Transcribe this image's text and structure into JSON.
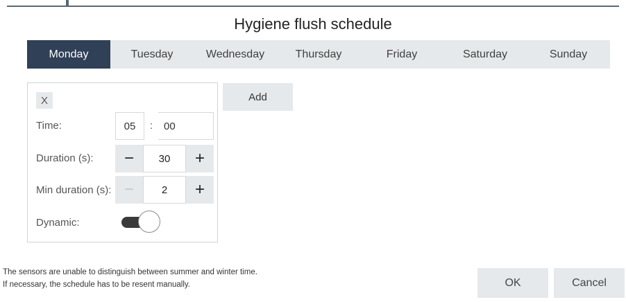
{
  "dialog": {
    "title": "Hygiene flush schedule"
  },
  "tabs": [
    {
      "label": "Monday",
      "active": true
    },
    {
      "label": "Tuesday",
      "active": false
    },
    {
      "label": "Wednesday",
      "active": false
    },
    {
      "label": "Thursday",
      "active": false
    },
    {
      "label": "Friday",
      "active": false
    },
    {
      "label": "Saturday",
      "active": false
    },
    {
      "label": "Sunday",
      "active": false
    }
  ],
  "entry": {
    "close_label": "X",
    "time_label": "Time:",
    "time_hour": "05",
    "time_separator": ":",
    "time_minute": "00",
    "duration_label": "Duration (s):",
    "duration_value": "30",
    "min_duration_label": "Min duration (s):",
    "min_duration_value": "2",
    "minus_symbol": "−",
    "plus_symbol": "+",
    "dynamic_label": "Dynamic:",
    "dynamic_on": true
  },
  "add_label": "Add",
  "note_lines": [
    "The sensors are unable to distinguish between summer and winter time.",
    "If necessary, the schedule has to be resent manually."
  ],
  "footer": {
    "ok_label": "OK",
    "cancel_label": "Cancel"
  },
  "colors": {
    "tab_active_bg": "#2f4057",
    "control_bg": "#e6e9eb",
    "toggle_track": "#3a3a3a"
  }
}
